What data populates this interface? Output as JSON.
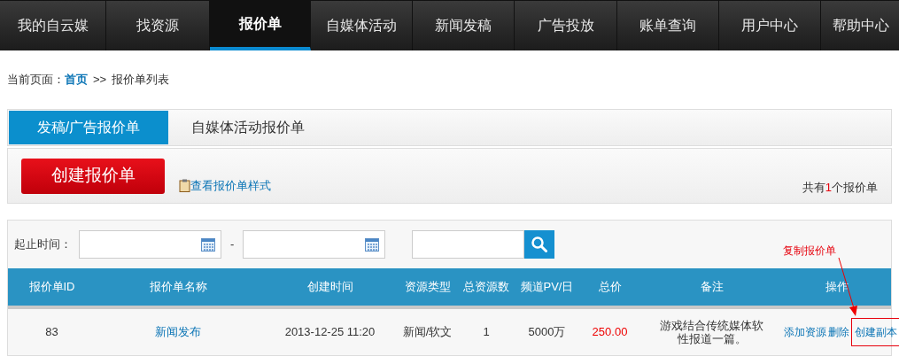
{
  "nav": [
    {
      "label": "我的自云媒",
      "selected": false
    },
    {
      "label": "找资源",
      "selected": false
    },
    {
      "label": "报价单",
      "selected": true
    },
    {
      "label": "自媒体活动",
      "selected": false
    },
    {
      "label": "新闻发稿",
      "selected": false
    },
    {
      "label": "广告投放",
      "selected": false
    },
    {
      "label": "账单查询",
      "selected": false
    },
    {
      "label": "用户中心",
      "selected": false
    },
    {
      "label": "帮助中心",
      "selected": false
    }
  ],
  "breadcrumb": {
    "prefix": "当前页面：",
    "home": "首页",
    "separator": ">>",
    "current": "报价单列表"
  },
  "tabs": [
    {
      "label": "发稿/广告报价单",
      "selected": true
    },
    {
      "label": "自媒体活动报价单",
      "selected": false
    }
  ],
  "create_button": "创建报价单",
  "sample_link": "查看报价单样式",
  "count_text": {
    "before": "共有",
    "count": "1",
    "after": "个报价单"
  },
  "filter": {
    "label": "起止时间：",
    "separator": "-"
  },
  "annotation": "复制报价单",
  "table": {
    "columns": [
      "报价单ID",
      "报价单名称",
      "创建时间",
      "资源类型",
      "总资源数",
      "频道PV/日",
      "总价",
      "备注",
      "操作"
    ],
    "rows": [
      {
        "id": "83",
        "name": "新闻发布",
        "created": "2013-12-25 11:20",
        "type": "新闻/软文",
        "count": "1",
        "pv": "5000万",
        "price": "250.00",
        "note": "游戏结合传统媒体软性报道一篇。",
        "actions": [
          {
            "label": "添加资源",
            "boxed": false
          },
          {
            "label": "删除",
            "boxed": false
          },
          {
            "label": "创建副本",
            "boxed": true
          }
        ]
      }
    ]
  }
}
